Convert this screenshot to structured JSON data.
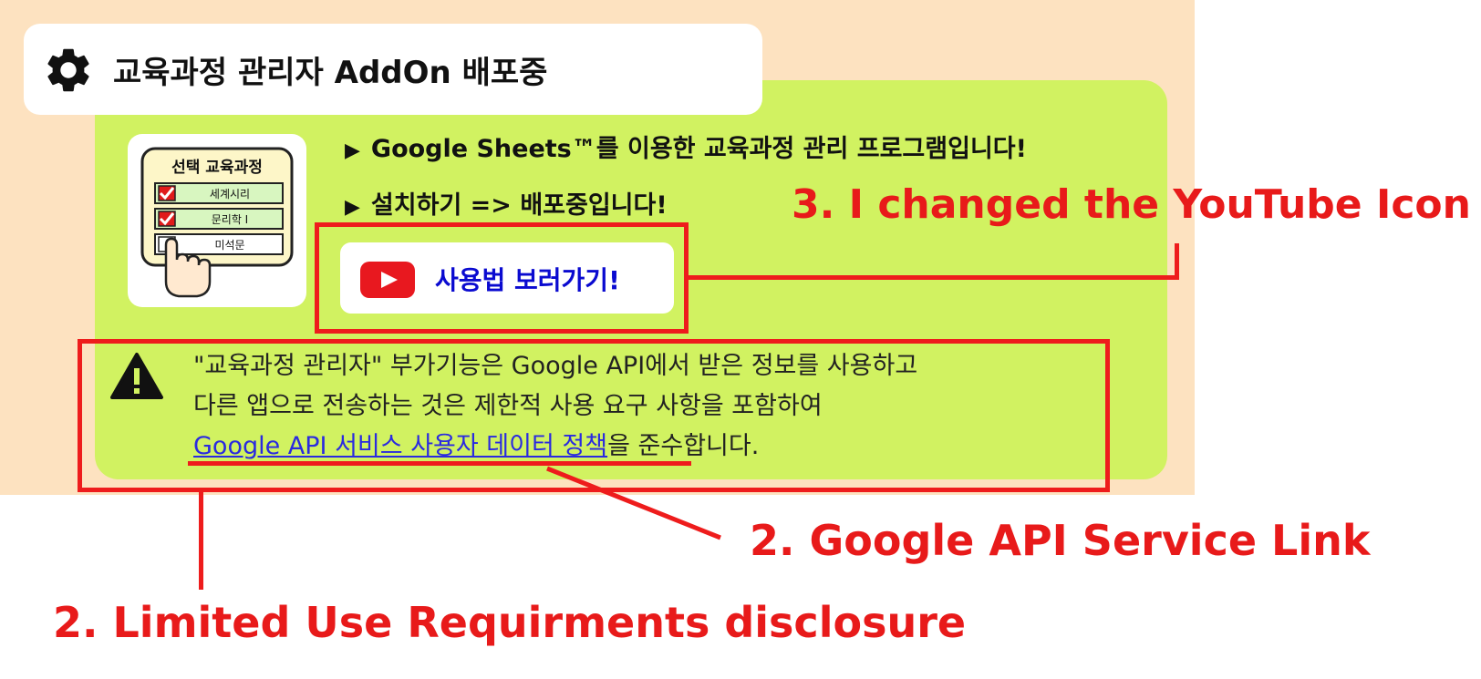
{
  "title": "교육과정 관리자 AddOn 배포중",
  "bullets": [
    "Google Sheets™를 이용한 교육과정 관리 프로그램입니다!",
    "설치하기 => 배포중입니다!"
  ],
  "thumbnail": {
    "heading": "선택 교육과정",
    "options": [
      {
        "label": "세계시리",
        "checked": true
      },
      {
        "label": "문리학 I",
        "checked": true
      },
      {
        "label": "미석문",
        "checked": false
      }
    ]
  },
  "youtube_button": {
    "label": "사용법 보러가기!",
    "icon": "youtube-play-icon"
  },
  "notice": {
    "line1": "\"교육과정 관리자\" 부가기능은 Google API에서 받은 정보를 사용하고",
    "line2": "다른 앱으로 전송하는 것은 제한적 사용 요구 사항을 포함하여",
    "link": "Google API 서비스 사용자 데이터 정책",
    "tail": "을 준수합니다."
  },
  "annotations": {
    "youtube": "3. I changed the YouTube Icon",
    "link": "2. Google API Service Link",
    "disclosure": "2. Limited Use Requirments disclosure"
  },
  "colors": {
    "peach": "#fde2c0",
    "green": "#d1f261",
    "annotation_red": "#ee1c1c",
    "link_blue": "#2a2ae0",
    "youtube_red": "#e8181f"
  }
}
